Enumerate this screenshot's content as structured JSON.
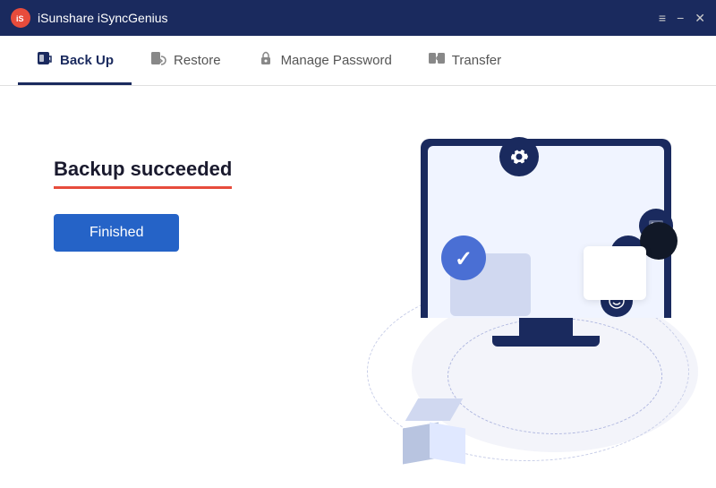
{
  "app": {
    "title": "iSunshare iSyncGenius",
    "logo_text": "iS"
  },
  "titlebar": {
    "menu_icon": "≡",
    "minimize_icon": "−",
    "close_icon": "✕"
  },
  "nav": {
    "tabs": [
      {
        "id": "backup",
        "label": "Back Up",
        "active": true
      },
      {
        "id": "restore",
        "label": "Restore",
        "active": false
      },
      {
        "id": "manage-password",
        "label": "Manage Password",
        "active": false
      },
      {
        "id": "transfer",
        "label": "Transfer",
        "active": false
      }
    ]
  },
  "main": {
    "success_title": "Backup succeeded",
    "finished_button": "Finished"
  },
  "colors": {
    "primary": "#1a2a5e",
    "accent_red": "#e74c3c",
    "btn_blue": "#2563c7"
  }
}
